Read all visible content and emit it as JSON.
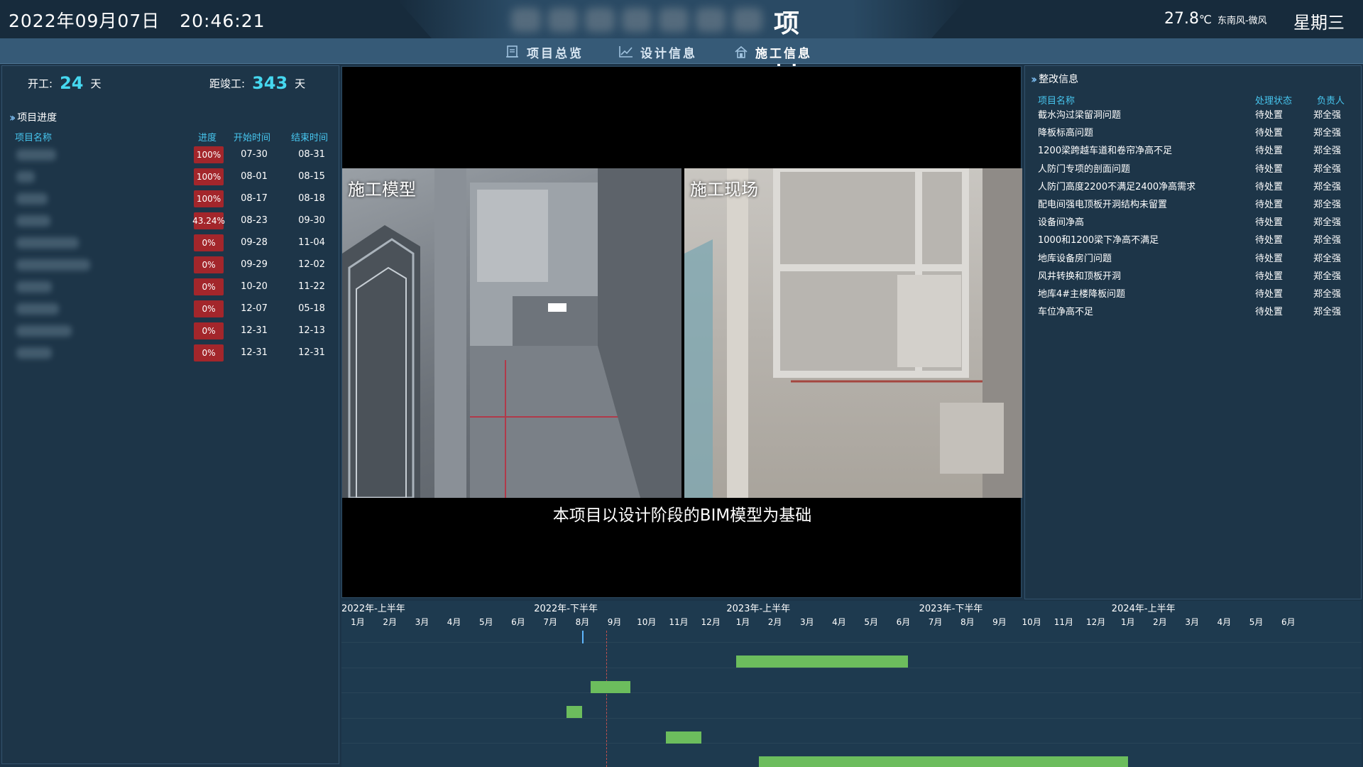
{
  "header": {
    "date": "2022年09月07日",
    "time": "20:46:21",
    "title": "项 目",
    "temperature": "27.8",
    "temp_unit": "℃",
    "wind": "东南风-微风",
    "weekday": "星期三"
  },
  "nav": {
    "items": [
      {
        "label": "项目总览",
        "icon": "document-icon"
      },
      {
        "label": "设计信息",
        "icon": "chart-icon"
      },
      {
        "label": "施工信息",
        "icon": "house-icon"
      }
    ],
    "active": "施工信息"
  },
  "left": {
    "start_label": "开工:",
    "start_days": "24",
    "start_unit": "天",
    "remain_label": "距竣工:",
    "remain_days": "343",
    "remain_unit": "天",
    "section_title": "项目进度",
    "columns": {
      "name": "项目名称",
      "progress": "进度",
      "start": "开始时间",
      "end": "结束时间"
    },
    "rows": [
      {
        "progress": "100%",
        "start": "07-30",
        "end": "08-31"
      },
      {
        "progress": "100%",
        "start": "08-01",
        "end": "08-15"
      },
      {
        "progress": "100%",
        "start": "08-17",
        "end": "08-18"
      },
      {
        "progress": "43.24%",
        "start": "08-23",
        "end": "09-30"
      },
      {
        "progress": "0%",
        "start": "09-28",
        "end": "11-04"
      },
      {
        "progress": "0%",
        "start": "09-29",
        "end": "12-02"
      },
      {
        "progress": "0%",
        "start": "10-20",
        "end": "11-22"
      },
      {
        "progress": "0%",
        "start": "12-07",
        "end": "05-18"
      },
      {
        "progress": "0%",
        "start": "12-31",
        "end": "12-13"
      },
      {
        "progress": "0%",
        "start": "12-31",
        "end": "12-31"
      }
    ]
  },
  "video": {
    "left_label": "施工模型",
    "right_label": "施工现场",
    "caption": "本项目以设计阶段的BIM模型为基础"
  },
  "right": {
    "section_title": "整改信息",
    "columns": {
      "name": "项目名称",
      "status": "处理状态",
      "owner": "负责人"
    },
    "rows": [
      {
        "name": "截水沟过梁留洞问题",
        "status": "待处置",
        "owner": "郑全强"
      },
      {
        "name": "降板标高问题",
        "status": "待处置",
        "owner": "郑全强"
      },
      {
        "name": "1200梁跨越车道和卷帘净高不足",
        "status": "待处置",
        "owner": "郑全强"
      },
      {
        "name": "人防门专项的剖面问题",
        "status": "待处置",
        "owner": "郑全强"
      },
      {
        "name": "人防门高度2200不满足2400净高需求",
        "status": "待处置",
        "owner": "郑全强"
      },
      {
        "name": "配电间强电顶板开洞结构未留置",
        "status": "待处置",
        "owner": "郑全强"
      },
      {
        "name": "设备间净高",
        "status": "待处置",
        "owner": "郑全强"
      },
      {
        "name": "1000和1200梁下净高不满足",
        "status": "待处置",
        "owner": "郑全强"
      },
      {
        "name": "地库设备房门问题",
        "status": "待处置",
        "owner": "郑全强"
      },
      {
        "name": "风井转换和顶板开洞",
        "status": "待处置",
        "owner": "郑全强"
      },
      {
        "name": "地库4#主楼降板问题",
        "status": "待处置",
        "owner": "郑全强"
      },
      {
        "name": "车位净高不足",
        "status": "待处置",
        "owner": "郑全强"
      }
    ]
  },
  "gantt": {
    "halves": [
      "2022年-上半年",
      "2022年-下半年",
      "2023年-上半年",
      "2023年-下半年",
      "2024年-上半年"
    ],
    "months": [
      "1月",
      "2月",
      "3月",
      "4月",
      "5月",
      "6月",
      "7月",
      "8月",
      "9月",
      "10月",
      "11月",
      "12月",
      "1月",
      "2月",
      "3月",
      "4月",
      "5月",
      "6月",
      "7月",
      "8月",
      "9月",
      "10月",
      "11月",
      "12月",
      "1月",
      "2月",
      "3月",
      "4月",
      "5月",
      "6月"
    ],
    "bars": [
      {
        "start_month": 11.8,
        "end_month": 17.15
      },
      {
        "start_month": 7.25,
        "end_month": 8.5
      },
      {
        "start_month": 6.5,
        "end_month": 7.0
      },
      {
        "start_month": 9.6,
        "end_month": 10.7
      },
      {
        "start_month": 12.5,
        "end_month": 24.0
      }
    ],
    "today_month": 7.75,
    "marker_month": 7.0
  },
  "colors": {
    "accent": "#46d8f0",
    "badge": "#a3262b",
    "bar": "#6cbd5d",
    "background": "#1c3448"
  }
}
